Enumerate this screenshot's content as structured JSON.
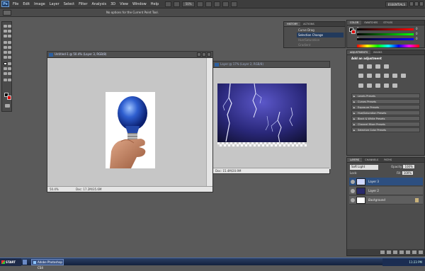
{
  "menubar": {
    "logo": "Ps",
    "items": [
      "File",
      "Edit",
      "Image",
      "Layer",
      "Select",
      "Filter",
      "Analysis",
      "3D",
      "View",
      "Window",
      "Help"
    ],
    "zoom": "50%",
    "workspace": "ESSENTIALS"
  },
  "options_bar": {
    "message": "No options for the Current Point Tool."
  },
  "doc1": {
    "title": "Untitled-1 @ 50.4% (Layer 3, RGB/8)",
    "zoom": "50.4%",
    "doc_info": "Doc: 17.2M/35.6M"
  },
  "doc2": {
    "title": "Layer @ 17% (Layer 2, RGB/8)",
    "doc_info": "Doc: 15.4M/20.9M"
  },
  "history": {
    "tabs": [
      "HISTORY",
      "ACTIONS"
    ],
    "rows": [
      {
        "label": "Curve Drag",
        "state": "normal"
      },
      {
        "label": "Selection Change",
        "state": "selected"
      },
      {
        "label": "Hue/Saturation",
        "state": "dim"
      },
      {
        "label": "Gradient",
        "state": "dim"
      }
    ]
  },
  "color_panel": {
    "tabs": [
      "COLOR",
      "SWATCHES",
      "STYLES"
    ],
    "channels": [
      {
        "name": "R",
        "value": "0",
        "color": "#e02020"
      },
      {
        "name": "G",
        "value": "0",
        "color": "#20c020"
      },
      {
        "name": "B",
        "value": "0",
        "color": "#2040e0"
      }
    ]
  },
  "adjustments": {
    "tabs": [
      "ADJUSTMENTS",
      "MASKS"
    ],
    "title": "Add an adjustment",
    "presets": [
      "Levels Presets",
      "Curves Presets",
      "Exposure Presets",
      "Hue/Saturation Presets",
      "Black & White Presets",
      "Channel Mixer Presets",
      "Selective Color Presets"
    ]
  },
  "layers": {
    "tabs": [
      "LAYERS",
      "CHANNELS",
      "PATHS"
    ],
    "blend_mode": "Soft Light",
    "opacity_label": "Opacity:",
    "opacity": "100%",
    "lock_label": "Lock:",
    "fill_label": "Fill:",
    "fill": "100%",
    "items": [
      {
        "name": "Layer 3",
        "selected": true
      },
      {
        "name": "Layer 2",
        "selected": false
      },
      {
        "name": "Background",
        "selected": false
      }
    ]
  },
  "taskbar": {
    "start": "START",
    "task": "Adobe Photoshop CS4",
    "clock": "11:23 PM"
  },
  "colors": {
    "fg": "#000000",
    "bg": "#e00000",
    "accent": "#2d4f80"
  }
}
